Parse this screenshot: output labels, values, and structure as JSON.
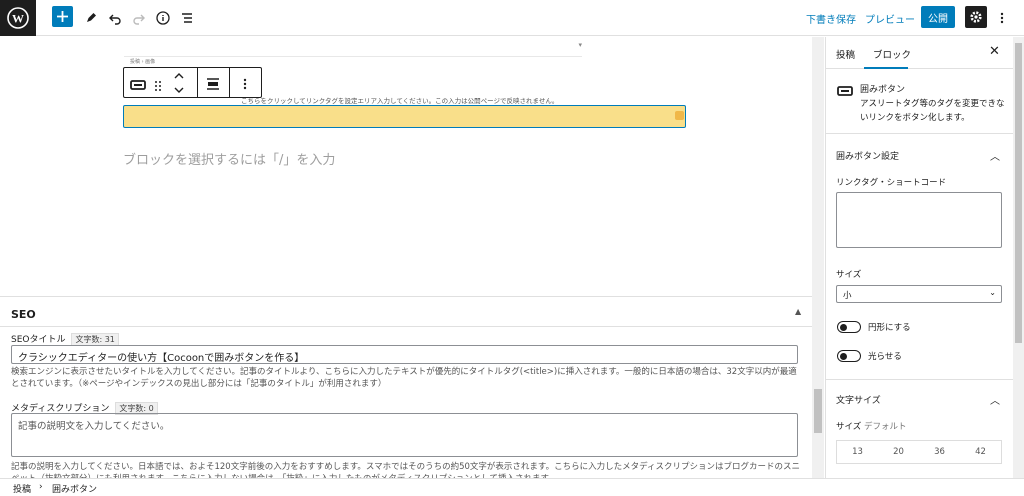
{
  "header": {
    "draft_save": "下書き保存",
    "preview": "プレビュー",
    "publish": "公開",
    "icons": [
      "wordpress-logo",
      "plus-icon",
      "pen-icon",
      "undo-icon",
      "redo-icon",
      "info-icon",
      "list-view-icon",
      "gear-icon",
      "more-vertical-icon"
    ]
  },
  "editor": {
    "mini_breadcrumb": "投稿 › 画像",
    "block_notice": "こちらをクリックしてリンクタグを設定エリア入力してください。この入力は公開ページで反映されません。",
    "placeholder": "ブロックを選択するには「/」を入力",
    "block_color": "#f9df8a"
  },
  "seo": {
    "title": "SEO",
    "seo_title_label": "SEOタイトル",
    "seo_title_count": "文字数: 31",
    "seo_title_value": "クラシックエディターの使い方【Cocoonで囲みボタンを作る】",
    "seo_title_help": "検索エンジンに表示させたいタイトルを入力してください。記事のタイトルより、こちらに入力したテキストが優先的にタイトルタグ(<title>)に挿入されます。一般的に日本語の場合は、32文字以内が最適とされています。（※ページやインデックスの見出し部分には「記事のタイトル」が利用されます）",
    "meta_label": "メタディスクリプション",
    "meta_count": "文字数: 0",
    "meta_placeholder": "記事の説明文を入力してください。",
    "meta_help": "記事の説明を入力してください。日本語では、およそ120文字前後の入力をおすすめします。スマホではそのうちの約50文字が表示されます。こちらに入力したメタディスクリプションはブログカードのスニペット（抜粋文部分）にも利用されます。こちらに入力しない場合は、「抜粋」に入力したものがメタディスクリプションとして挿入されます。"
  },
  "sidebar": {
    "tab_post": "投稿",
    "tab_block": "ブロック",
    "block_name": "囲みボタン",
    "block_desc": "アスリートタグ等のタグを変更できないリンクをボタン化します。",
    "panel_settings": "囲みボタン設定",
    "link_label": "リンクタグ・ショートコード",
    "size_label": "サイズ",
    "size_value": "小",
    "circle_label": "円形にする",
    "shine_label": "光らせる",
    "font_panel": "文字サイズ",
    "font_size_label": "サイズ",
    "font_size_default": "デフォルト",
    "font_presets": [
      "13",
      "20",
      "36",
      "42"
    ]
  },
  "footer": {
    "crumb_post": "投稿",
    "crumb_sep": "›",
    "crumb_block": "囲みボタン"
  },
  "colors": {
    "accent": "#007cba",
    "dark": "#1e1e1e"
  }
}
